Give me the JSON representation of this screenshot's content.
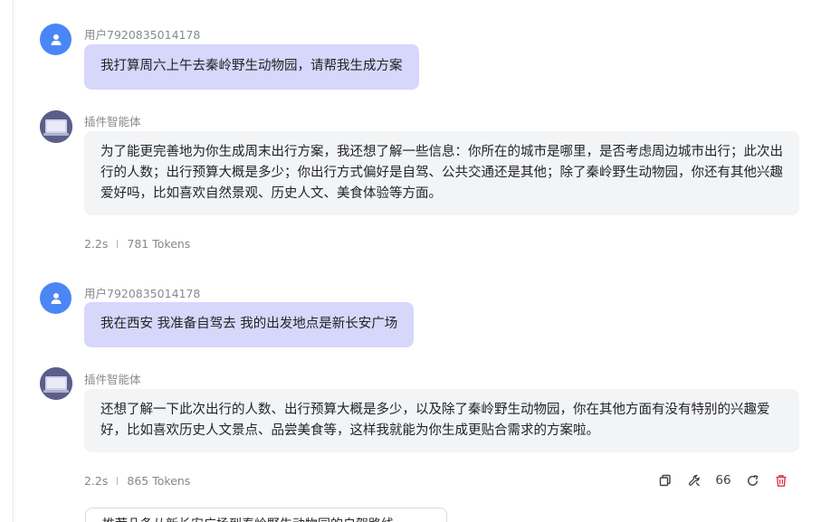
{
  "messages": [
    {
      "role": "user",
      "sender": "用户7920835014178",
      "text": "我打算周六上午去秦岭野生动物园，请帮我生成方案"
    },
    {
      "role": "bot",
      "sender": "插件智能体",
      "text": "为了能更完善地为你生成周末出行方案，我还想了解一些信息：你所在的城市是哪里，是否考虑周边城市出行；此次出行的人数；出行预算大概是多少；你出行方式偏好是自驾、公共交通还是其他；除了秦岭野生动物园，你还有其他兴趣爱好吗，比如喜欢自然景观、历史人文、美食体验等方面。",
      "time": "2.2s",
      "tokens": "781 Tokens"
    },
    {
      "role": "user",
      "sender": "用户7920835014178",
      "text": "我在西安 我准备自驾去 我的出发地点是新长安广场"
    },
    {
      "role": "bot",
      "sender": "插件智能体",
      "text": "还想了解一下此次出行的人数、出行预算大概是多少，以及除了秦岭野生动物园，你在其他方面有没有特别的兴趣爱好，比如喜欢历史人文景点、品尝美食等，这样我就能为你生成更贴合需求的方案啦。",
      "time": "2.2s",
      "tokens": "865 Tokens"
    }
  ],
  "actions": {
    "copy_icon": "copy-icon",
    "plugin_icon": "wrench-icon",
    "quote_label": "66",
    "regenerate_icon": "refresh-icon",
    "delete_icon": "trash-icon"
  },
  "suggestion": {
    "text": "推荐几条从新长安广场到秦岭野生动物园的自驾路线"
  },
  "colors": {
    "user_avatar": "#4b86f6",
    "user_bubble": "#d6d7fb",
    "bot_bubble": "#f3f4f6",
    "delete": "#e0323c"
  }
}
